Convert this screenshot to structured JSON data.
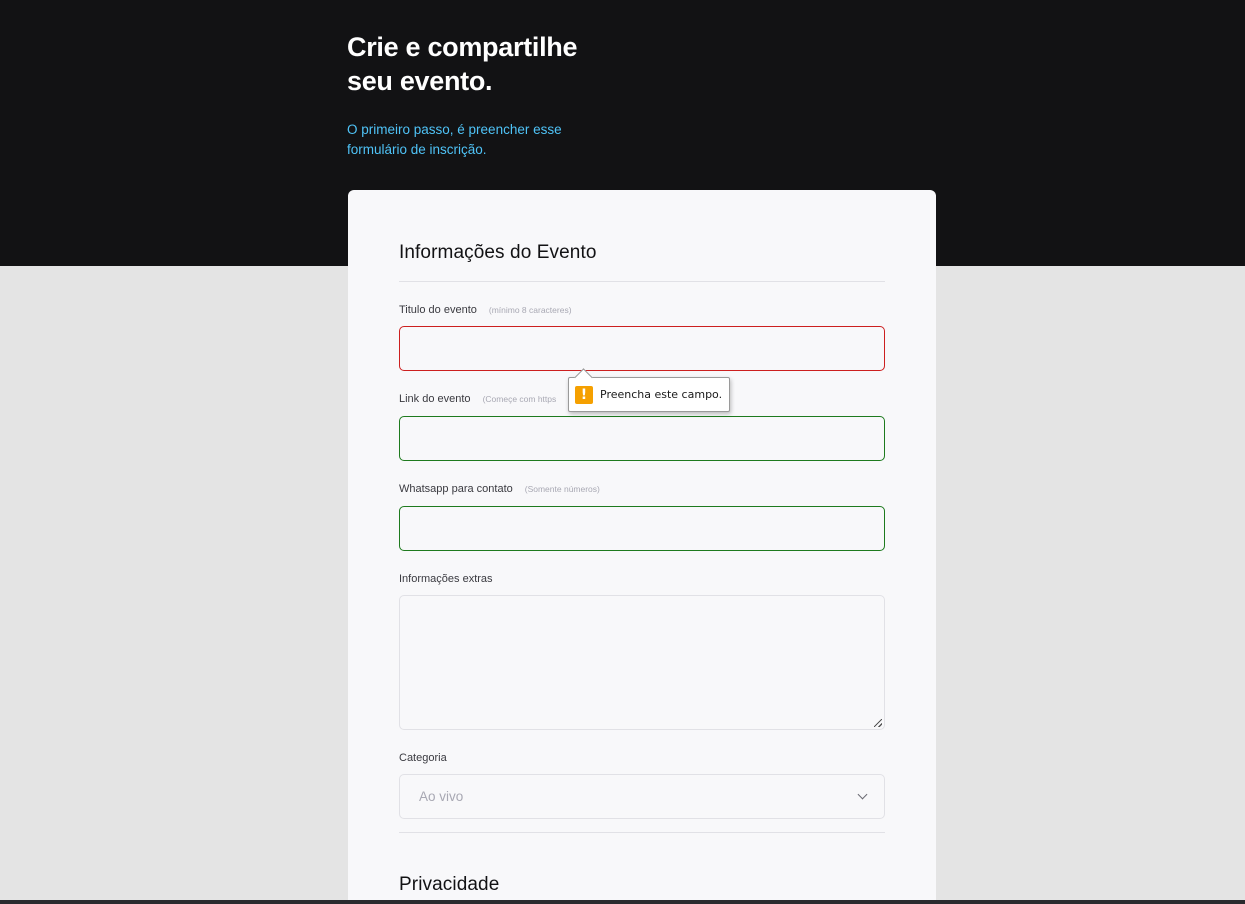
{
  "hero": {
    "title": "Crie e compartilhe\nseu evento.",
    "subtitle": "O primeiro passo, é preencher esse\nformulário de inscrição."
  },
  "form": {
    "section_event_title": "Informações do Evento",
    "fields": {
      "title": {
        "label": "Titulo do evento",
        "hint": "(mínimo 8 caracteres)",
        "value": ""
      },
      "link": {
        "label": "Link do evento",
        "hint": "(Começe com https",
        "value": ""
      },
      "whatsapp": {
        "label": "Whatsapp para contato",
        "hint": "(Somente números)",
        "value": ""
      },
      "extras": {
        "label": "Informações extras",
        "value": ""
      },
      "category": {
        "label": "Categoria",
        "selected": "Ao vivo"
      }
    },
    "section_privacy_title": "Privacidade"
  },
  "validation_tooltip": {
    "icon": "warning-icon",
    "message": "Preencha este campo."
  },
  "colors": {
    "header_bg": "#121214",
    "accent": "#4fc3f7",
    "invalid_border": "#cc1f1f",
    "valid_border": "#1e7a1e",
    "warning": "#f5a000"
  }
}
